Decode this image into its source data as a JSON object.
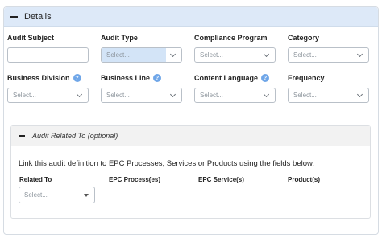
{
  "details": {
    "title": "Details"
  },
  "fields_row1": [
    {
      "label": "Audit Subject",
      "value": "",
      "placeholder": ""
    },
    {
      "label": "Audit Type",
      "placeholder": "Select..."
    },
    {
      "label": "Compliance Program",
      "placeholder": "Select..."
    },
    {
      "label": "Category",
      "placeholder": "Select..."
    }
  ],
  "fields_row2": [
    {
      "label": "Business Division",
      "placeholder": "Select...",
      "help": "?"
    },
    {
      "label": "Business Line",
      "placeholder": "Select...",
      "help": "?"
    },
    {
      "label": "Content Language",
      "placeholder": "Select...",
      "help": "?"
    },
    {
      "label": "Frequency",
      "placeholder": "Select..."
    }
  ],
  "related": {
    "title": "Audit Related To (optional)",
    "description": "Link this audit definition to EPC Processes, Services or Products using the fields below.",
    "columns": [
      "Related To",
      "EPC Process(es)",
      "EPC Service(s)",
      "Product(s)"
    ],
    "related_to_placeholder": "Select..."
  },
  "colors": {
    "header_bg": "#dde9f8",
    "selected_fill": "#d3e4f7",
    "help_icon": "#6fa6e8"
  }
}
